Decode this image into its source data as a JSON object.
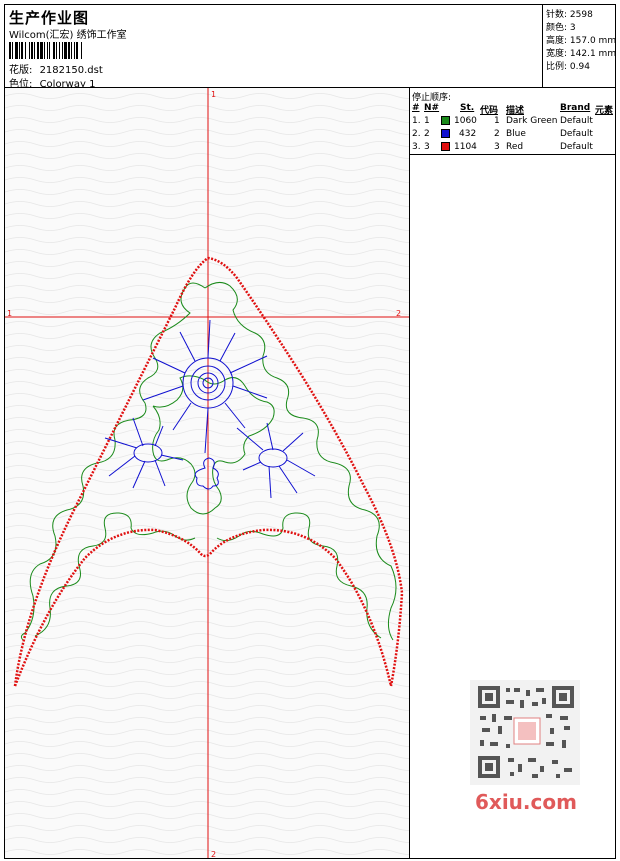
{
  "header": {
    "title": "生产作业图",
    "company": "Wilcom(汇宏) 绣饰工作室",
    "design_label": "花版:",
    "design_value": "2182150.dst",
    "colorway_label": "色位:",
    "colorway_value": "Colorway 1"
  },
  "stats": {
    "stitches_label": "针数:",
    "stitches_value": "2598",
    "colors_label": "颜色:",
    "colors_value": "3",
    "height_label": "高度:",
    "height_value": "157.0 mm",
    "width_label": "宽度:",
    "width_value": "142.1 mm",
    "scale_label": "比例:",
    "scale_value": "0.94"
  },
  "canvas": {
    "axis_top": "1",
    "axis_bottom": "2",
    "axis_left": "1",
    "axis_right": "2"
  },
  "stop_sequence": {
    "title": "停止顺序:",
    "columns": [
      "#",
      "N#",
      "St.",
      "代码",
      "描述",
      "Brand",
      "元素"
    ],
    "rows": [
      {
        "index": "1.",
        "needle": "1",
        "color": "#1a8a1a",
        "stitches": "1060",
        "code": "1",
        "description": "Dark Green",
        "brand": "Default"
      },
      {
        "index": "2.",
        "needle": "2",
        "color": "#1010d0",
        "stitches": "432",
        "code": "2",
        "description": "Blue",
        "brand": "Default"
      },
      {
        "index": "3.",
        "needle": "3",
        "color": "#e01010",
        "stitches": "1104",
        "code": "3",
        "description": "Red",
        "brand": "Default"
      }
    ]
  },
  "watermark": {
    "site": "6xiu.com"
  }
}
